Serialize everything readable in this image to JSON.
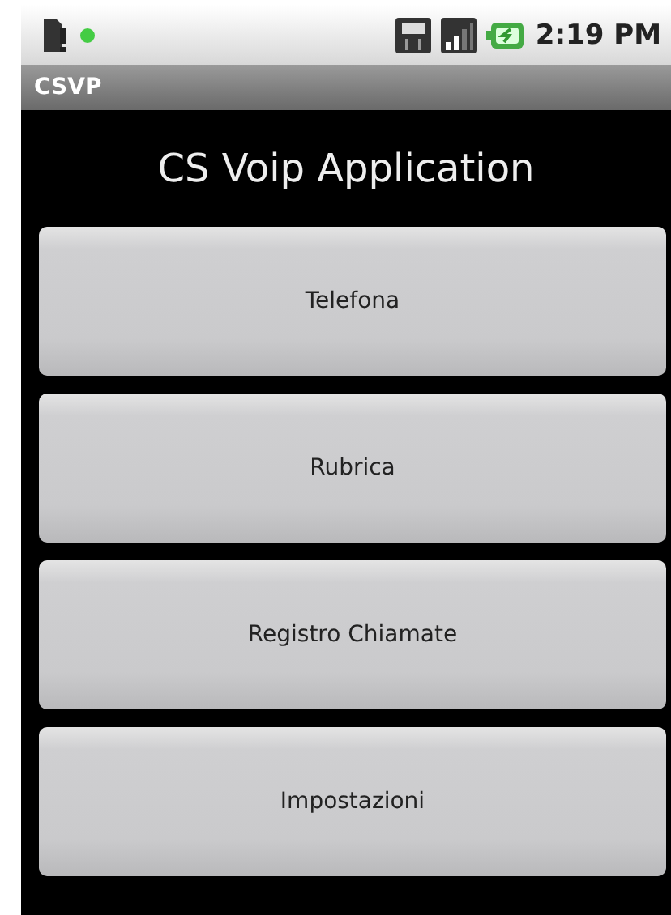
{
  "status_bar": {
    "time": "2:19 PM"
  },
  "title_bar": {
    "title": "CSVP"
  },
  "heading": "CS Voip Application",
  "buttons": [
    "Telefona",
    "Rubrica",
    "Registro Chiamate",
    "Impostazioni"
  ]
}
